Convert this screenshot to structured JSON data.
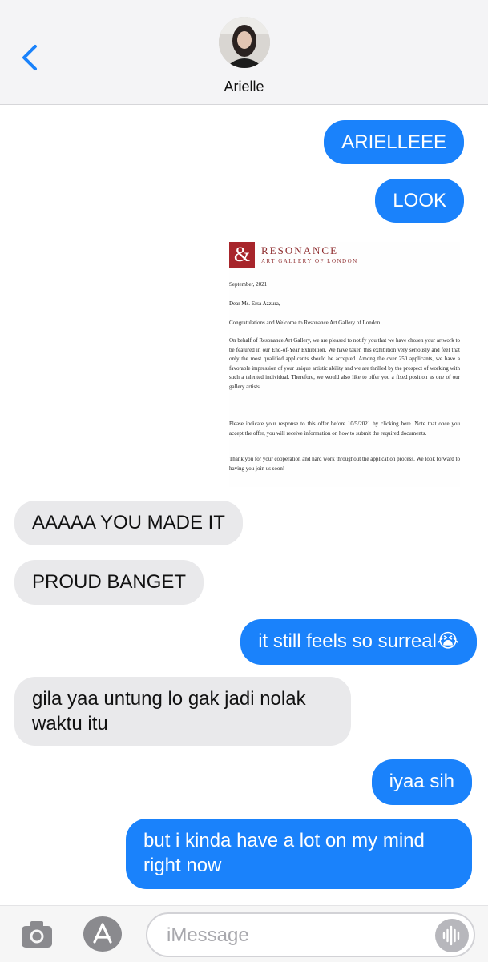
{
  "header": {
    "contact_name": "Arielle"
  },
  "messages": [
    {
      "side": "out",
      "text": "ARIELLEEE"
    },
    {
      "side": "out",
      "text": "LOOK"
    },
    {
      "side": "in",
      "text": "AAAAA YOU MADE IT"
    },
    {
      "side": "in",
      "text": "PROUD BANGET"
    },
    {
      "side": "out",
      "text": "it still feels so surreal😭"
    },
    {
      "side": "in",
      "text": "gila yaa untung lo gak jadi nolak waktu itu"
    },
    {
      "side": "out",
      "text": "iyaa sih"
    },
    {
      "side": "out",
      "text": "but i kinda have a lot on my mind right now"
    }
  ],
  "letter": {
    "brand": "RESONANCE",
    "brand_sub": "ART GALLERY OF LONDON",
    "logo_mark": "&",
    "date": "September, 2021",
    "salutation": "Dear Ms. Ersa Azzura,",
    "heading": "Congratulations and Welcome to Resonance Art Gallery of London!",
    "para1": "On behalf of Resonance Art Gallery, we are pleased to notify you that we have chosen your artwork to be featured in our End-of-Year Exhibition. We have taken this exhibition very seriously and feel that only the most qualified applicants should be accepted. Among the over 250 applicants, we have a favorable impression of your unique artistic ability and we are thrilled by the prospect of working with such a talented individual. Therefore, we would also like to offer you a fixed position as one of our gallery artists.",
    "para2": "Please indicate your response to this offer before 10/5/2021 by clicking here. Note that once you accept the offer, you will receive information on how to submit the required documents.",
    "para3": "Thank you for your cooperation and hard work throughout the application process. We look forward to having you join us soon!"
  },
  "composer": {
    "placeholder": "iMessage"
  },
  "colors": {
    "outgoing": "#1a82fb",
    "incoming": "#e9e9eb",
    "accent": "#1a82fb"
  },
  "icons": [
    "back-chevron-icon",
    "camera-icon",
    "app-store-icon",
    "voice-waveform-icon"
  ]
}
